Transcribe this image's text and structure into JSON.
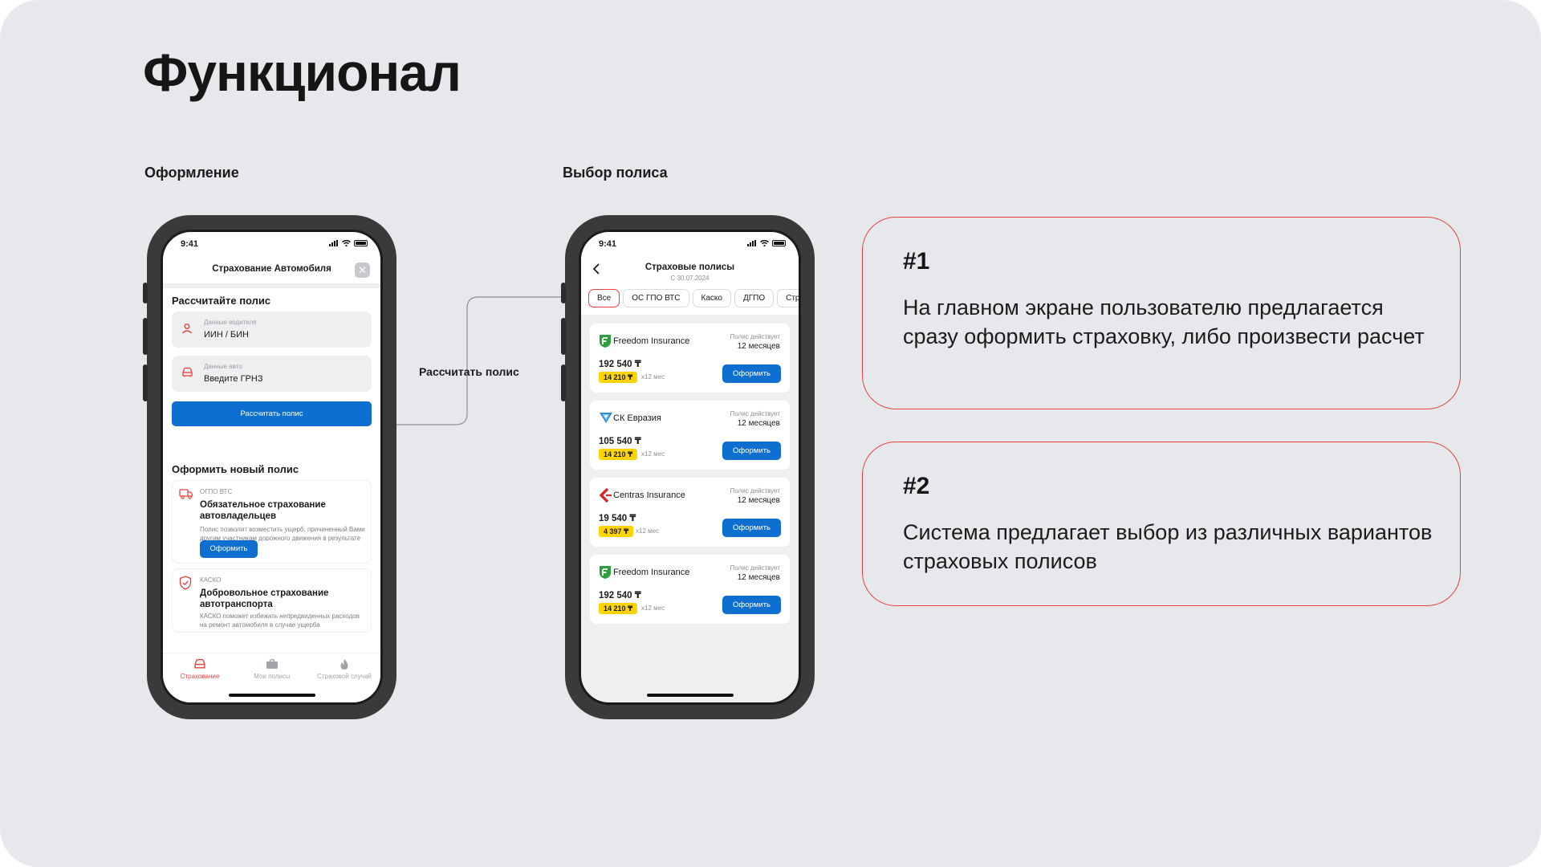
{
  "slide": {
    "title": "Функционал",
    "label_left": "Оформление",
    "label_right": "Выбор полиса",
    "connector_label": "Рассчитать полис"
  },
  "status_bar": {
    "time": "9:41"
  },
  "phone1": {
    "header_title": "Страхование Автомобиля",
    "close_icon": "close-icon",
    "calc_section": {
      "title": "Рассчитайте полис",
      "driver_field": {
        "label": "Данные водителя",
        "value": "ИИН / БИН",
        "icon": "person-icon"
      },
      "car_field": {
        "label": "Данные авто",
        "value": "Введите ГРНЗ",
        "icon": "car-icon"
      },
      "button": "Рассчитать полис"
    },
    "new_policy_section": {
      "title": "Оформить новый полис",
      "items": [
        {
          "tag": "ОГПО ВТС",
          "title": "Обязательное страхование автовладельцев",
          "desc": "Полис позволит возместить ущерб, причиненный Вами другим участникам дорожного движения в результате ДТП.",
          "button": "Оформить",
          "icon": "truck-icon"
        },
        {
          "tag": "КАСКО",
          "title": "Добровольное страхование автотранспорта",
          "desc": "КАСКО поможет избежать непредвиденных расходов на ремонт автомобиля в случае ущерба",
          "icon": "shield-icon"
        }
      ]
    },
    "tabs": [
      {
        "label": "Страхование",
        "icon": "car-icon",
        "active": true
      },
      {
        "label": "Мои полисы",
        "icon": "briefcase-icon",
        "active": false
      },
      {
        "label": "Страховой случай",
        "icon": "fire-icon",
        "active": false
      }
    ]
  },
  "phone2": {
    "header_title": "Страховые полисы",
    "header_subtitle": "С 30.07.2024",
    "filters": [
      "Все",
      "ОС ГПО ВТС",
      "Каско",
      "ДГПО",
      "Стр"
    ],
    "policy_period_label": "Полис действует",
    "policy_period_value": "12 месяцев",
    "per_month_suffix": "x12 мес",
    "order_button": "Оформить",
    "offers": [
      {
        "company": "Freedom Insurance",
        "price": "192 540 ₸",
        "monthly": "14 210 ₸",
        "logo": "freedom-logo-icon",
        "color": "#2e9e3e"
      },
      {
        "company": "СК Евразия",
        "price": "105 540 ₸",
        "monthly": "14 210 ₸",
        "logo": "eurasia-logo-icon",
        "color": "#2b8fd6"
      },
      {
        "company": "Centras Insurance",
        "price": "19 540 ₸",
        "monthly": "4 397 ₸",
        "logo": "centras-logo-icon",
        "color": "#d62828"
      },
      {
        "company": "Freedom Insurance",
        "price": "192 540 ₸",
        "monthly": "14 210 ₸",
        "logo": "freedom-logo-icon",
        "color": "#2e9e3e"
      }
    ]
  },
  "info_boxes": [
    {
      "number": "#1",
      "text": "На главном экране пользователю предлагается сразу оформить страховку, либо произвести расчет"
    },
    {
      "number": "#2",
      "text": "Система предлагает выбор из различных вариантов страховых полисов"
    }
  ],
  "colors": {
    "accent": "#e8423f",
    "primary_button": "#0d6fd0",
    "highlight": "#ffd400",
    "background": "#e6e8eb"
  }
}
